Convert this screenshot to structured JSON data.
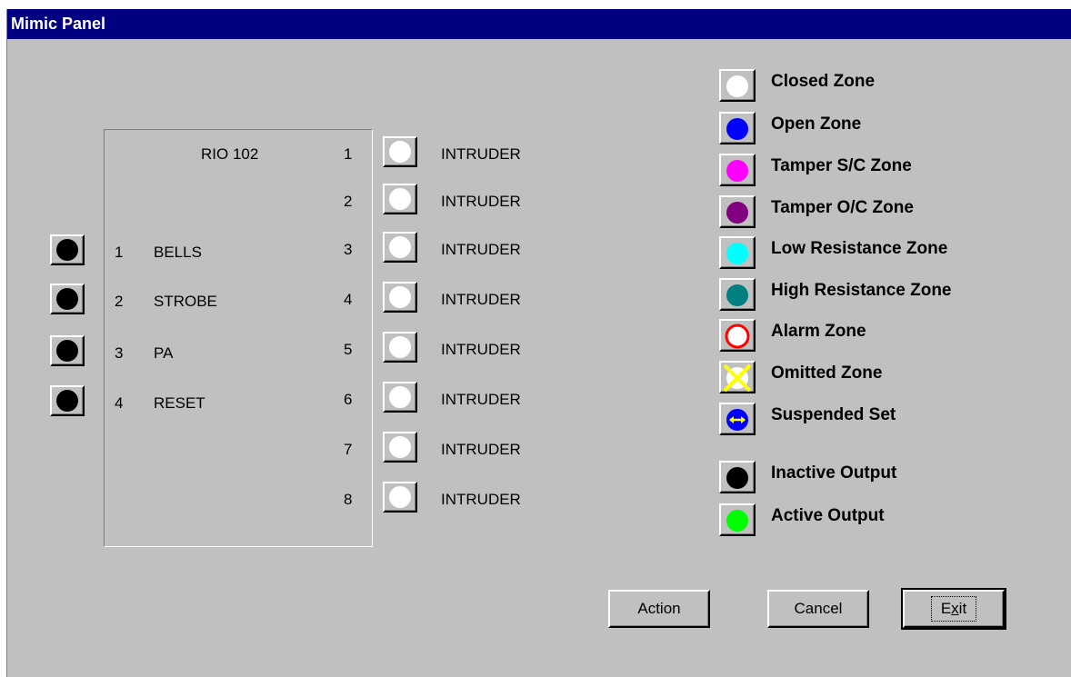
{
  "window": {
    "title": "Mimic Panel"
  },
  "panel": {
    "name": "RIO 102",
    "outputs": [
      {
        "num": "1",
        "label": "BELLS",
        "color": "#000000"
      },
      {
        "num": "2",
        "label": "STROBE",
        "color": "#000000"
      },
      {
        "num": "3",
        "label": "PA",
        "color": "#000000"
      },
      {
        "num": "4",
        "label": "RESET",
        "color": "#000000"
      }
    ],
    "zones": [
      {
        "num": "1",
        "label": "INTRUDER",
        "color": "#ffffff"
      },
      {
        "num": "2",
        "label": "INTRUDER",
        "color": "#ffffff"
      },
      {
        "num": "3",
        "label": "INTRUDER",
        "color": "#ffffff"
      },
      {
        "num": "4",
        "label": "INTRUDER",
        "color": "#ffffff"
      },
      {
        "num": "5",
        "label": "INTRUDER",
        "color": "#ffffff"
      },
      {
        "num": "6",
        "label": "INTRUDER",
        "color": "#ffffff"
      },
      {
        "num": "7",
        "label": "INTRUDER",
        "color": "#ffffff"
      },
      {
        "num": "8",
        "label": "INTRUDER",
        "color": "#ffffff"
      }
    ]
  },
  "legend": [
    {
      "label": "Closed Zone",
      "icon": "white-circle-icon"
    },
    {
      "label": "Open Zone",
      "icon": "blue-circle-icon"
    },
    {
      "label": "Tamper S/C Zone",
      "icon": "magenta-circle-icon"
    },
    {
      "label": "Tamper O/C Zone",
      "icon": "purple-circle-icon"
    },
    {
      "label": "Low Resistance Zone",
      "icon": "cyan-circle-icon"
    },
    {
      "label": "High Resistance Zone",
      "icon": "teal-circle-icon"
    },
    {
      "label": "Alarm Zone",
      "icon": "red-ring-icon"
    },
    {
      "label": "Omitted Zone",
      "icon": "yellow-cross-icon"
    },
    {
      "label": "Suspended Set",
      "icon": "blue-arrow-circle-icon"
    },
    {
      "label": "Inactive Output",
      "icon": "black-circle-icon"
    },
    {
      "label": "Active Output",
      "icon": "green-circle-icon"
    }
  ],
  "legend_colors": {
    "closed": "#ffffff",
    "open": "#0000ff",
    "tamper_sc": "#ff00ff",
    "tamper_oc": "#800080",
    "low_res": "#00ffff",
    "high_res": "#008080",
    "alarm": "#ff0000",
    "omitted": "#ffff00",
    "suspended": "#0000ff",
    "inactive": "#000000",
    "active": "#00ff00"
  },
  "buttons": {
    "action": "Action",
    "cancel": "Cancel",
    "exit": "Exit"
  }
}
